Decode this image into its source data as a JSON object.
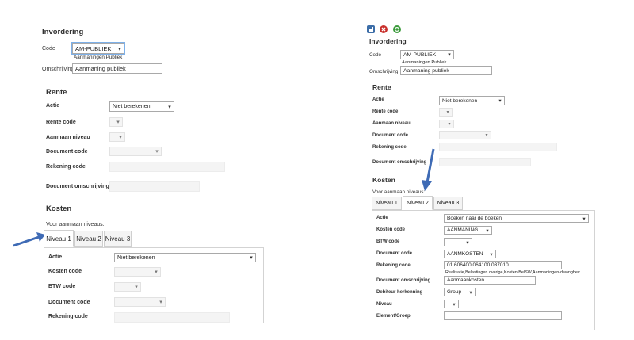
{
  "left": {
    "invordering_heading": "Invordering",
    "code_label": "Code",
    "code_value": "AM-PUBLIEK",
    "code_hint": "Aanmaningen Publiek",
    "omschrijving_label": "Omschrijving",
    "omschrijving_value": "Aanmaning publiek",
    "rente_heading": "Rente",
    "actie_label": "Actie",
    "actie_value": "Niet berekenen",
    "rente_code_label": "Rente code",
    "aanmaan_niveau_label": "Aanmaan niveau",
    "document_code_label": "Document code",
    "rekening_code_label": "Rekening code",
    "document_omschrijving_label": "Document omschrijving",
    "kosten_heading": "Kosten",
    "voor_aanmaan_label": "Voor aanmaan niveaus:",
    "tabs": [
      "Niveau 1",
      "Niveau 2",
      "Niveau 3"
    ],
    "panel": {
      "actie_label": "Actie",
      "actie_value": "Niet berekenen",
      "kosten_code_label": "Kosten code",
      "btw_code_label": "BTW code",
      "document_code_label": "Document code",
      "rekening_code_label": "Rekening code"
    }
  },
  "right": {
    "invordering_heading": "Invordering",
    "code_label": "Code",
    "code_value": "AM-PUBLIEK",
    "code_hint": "Aanmaningen Publiek",
    "omschrijving_label": "Omschrijving",
    "omschrijving_value": "Aanmaning publiek",
    "rente_heading": "Rente",
    "actie_label": "Actie",
    "actie_value": "Niet berekenen",
    "rente_code_label": "Rente code",
    "aanmaan_niveau_label": "Aanmaan niveau",
    "document_code_label": "Document code",
    "rekening_code_label": "Rekening code",
    "document_omschrijving_label": "Document omschrijving",
    "kosten_heading": "Kosten",
    "voor_aanmaan_label": "Voor aanmaan niveaus:",
    "tabs": [
      "Niveau 1",
      "Niveau 2",
      "Niveau 3"
    ],
    "panel": {
      "actie_label": "Actie",
      "actie_value": "Boeken naar de boeken",
      "kosten_code_label": "Kosten code",
      "kosten_code_value": "AANMANING",
      "btw_code_label": "BTW code",
      "document_code_label": "Document code",
      "document_code_value": "AANMKOSTEN",
      "rekening_code_label": "Rekening code",
      "rekening_code_value": "01.606400.064100.037010",
      "rekening_code_hint": "Realisatie,Belastingen overige,Kosten BelSW,Aanmaningen-dwangbev",
      "document_omschrijving_label": "Document omschrijving",
      "document_omschrijving_value": "Aanmaankosten",
      "debiteur_label": "Debiteur herkenning",
      "debiteur_value": "Group",
      "niveau_label": "Niveau",
      "element_label": "Element/Groep"
    }
  },
  "icons": {
    "save": "floppy-icon",
    "cancel": "cancel-icon",
    "refresh": "refresh-icon",
    "dropdown": "chevron-down-icon",
    "arrow": "arrow-icon"
  },
  "colors": {
    "arrow": "#3f6bb5",
    "focus": "#7db0e8"
  }
}
